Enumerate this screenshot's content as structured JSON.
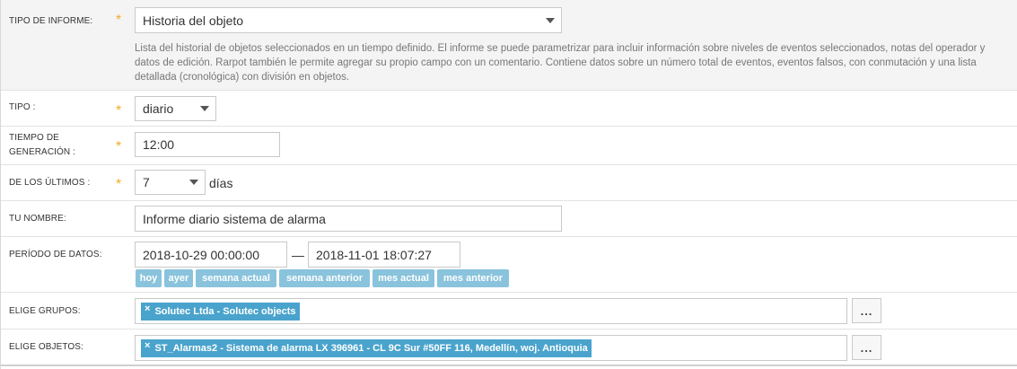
{
  "report_type": {
    "label": "TIPO DE INFORME:",
    "value": "Historia del objeto",
    "description": "Lista del historial de objetos seleccionados en un tiempo definido. El informe se puede parametrizar para incluir información sobre niveles de eventos seleccionados, notas del operador y datos de edición. Rarpot también le permite agregar su propio campo con un comentario. Contiene datos sobre un número total de eventos, eventos falsos, con conmutación y una lista detallada (cronológica) con división en objetos."
  },
  "type": {
    "label": "TIPO :",
    "value": "diario"
  },
  "generation_time": {
    "label_line1": "TIEMPO DE",
    "label_line2": "GENERACIÓN :",
    "value": "12:00"
  },
  "last": {
    "label": "DE LOS ÚLTIMOS :",
    "value": "7",
    "suffix": "días"
  },
  "name": {
    "label": "TU NOMBRE:",
    "value": "Informe diario sistema de alarma"
  },
  "period": {
    "label": "PERÍODO DE DATOS:",
    "from": "2018-10-29 00:00:00",
    "separator": "—",
    "to": "2018-11-01 18:07:27",
    "quick": [
      "hoy",
      "ayer",
      "semana actual",
      "semana anterior",
      "mes actual",
      "mes anterior"
    ]
  },
  "groups": {
    "label": "ELIGE GRUPOS:",
    "tag": "Solutec Ltda - Solutec objects",
    "more": "..."
  },
  "objects": {
    "label": "ELIGE OBJETOS:",
    "tag": "ST_Alarmas2 - Sistema de alarma LX 396961 - CL 9C Sur #50FF 116, Medellín, woj. Antioquia",
    "more": "..."
  },
  "required_mark": "*",
  "remove_glyph": "×",
  "colors": {
    "required": "#f0ad2a",
    "quick_button": "#8ac3dc",
    "tag": "#4aa3cc"
  }
}
